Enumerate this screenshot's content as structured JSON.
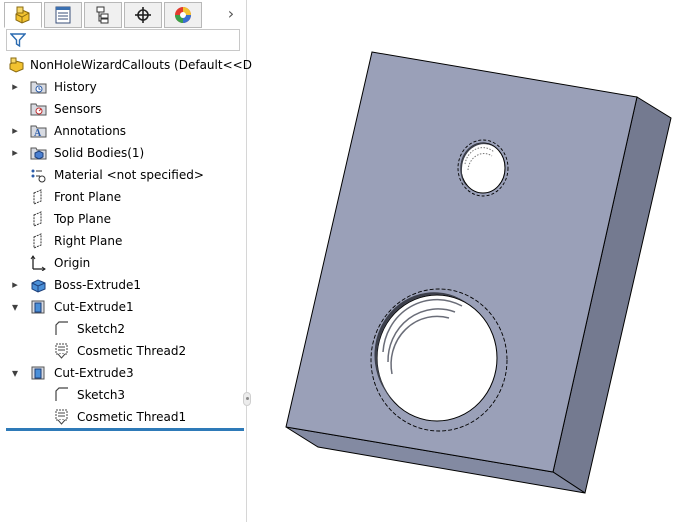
{
  "tabs": [
    {
      "id": "feature-manager",
      "icon": "feature-manager-icon",
      "active": true
    },
    {
      "id": "property-manager",
      "icon": "property-manager-icon",
      "active": false
    },
    {
      "id": "configuration-manager",
      "icon": "configuration-manager-icon",
      "active": false
    },
    {
      "id": "dimxpert-manager",
      "icon": "dimxpert-icon",
      "active": false
    },
    {
      "id": "display-manager",
      "icon": "display-manager-icon",
      "active": false
    }
  ],
  "tree": {
    "root_label": "NonHoleWizardCallouts  (Default<<Defa",
    "items": [
      {
        "label": "History",
        "icon": "history-folder-icon",
        "expander": "collapsed"
      },
      {
        "label": "Sensors",
        "icon": "sensors-folder-icon",
        "expander": "none"
      },
      {
        "label": "Annotations",
        "icon": "annotations-icon",
        "expander": "collapsed"
      },
      {
        "label": "Solid Bodies(1)",
        "icon": "solid-bodies-icon",
        "expander": "collapsed"
      },
      {
        "label": "Material <not specified>",
        "icon": "material-icon",
        "expander": "none"
      },
      {
        "label": "Front Plane",
        "icon": "plane-icon",
        "expander": "none"
      },
      {
        "label": "Top Plane",
        "icon": "plane-icon",
        "expander": "none"
      },
      {
        "label": "Right Plane",
        "icon": "plane-icon",
        "expander": "none"
      },
      {
        "label": "Origin",
        "icon": "origin-icon",
        "expander": "none"
      },
      {
        "label": "Boss-Extrude1",
        "icon": "boss-extrude-icon",
        "expander": "collapsed"
      },
      {
        "label": "Cut-Extrude1",
        "icon": "cut-extrude-icon",
        "expander": "expanded"
      },
      {
        "label": "Sketch2",
        "icon": "sketch-icon",
        "expander": "none",
        "child": true
      },
      {
        "label": "Cosmetic Thread2",
        "icon": "cosmetic-thread-icon",
        "expander": "none",
        "child": true
      },
      {
        "label": "Cut-Extrude3",
        "icon": "cut-extrude-icon",
        "expander": "expanded"
      },
      {
        "label": "Sketch3",
        "icon": "sketch-icon",
        "expander": "none",
        "child": true
      },
      {
        "label": "Cosmetic Thread1",
        "icon": "cosmetic-thread-icon",
        "expander": "none",
        "child": true
      }
    ]
  },
  "more_tabs_glyph": "›",
  "colors": {
    "rollback_bar": "#2e7ab8",
    "part_face": "#9aa0b8",
    "part_side": "#747a90"
  }
}
